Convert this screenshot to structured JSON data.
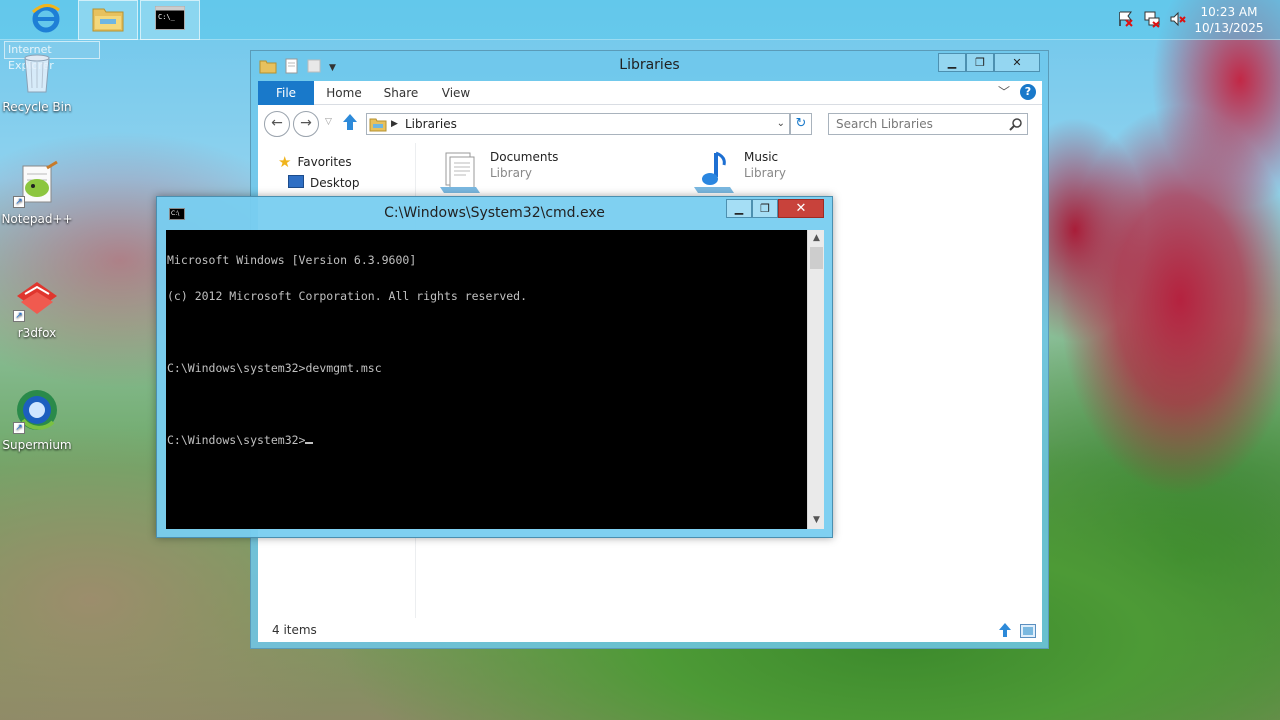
{
  "taskbar": {
    "items": [
      {
        "name": "internet-explorer-taskbar-button",
        "icon": "internet-explorer-icon"
      },
      {
        "name": "file-explorer-taskbar-button",
        "icon": "folder-icon"
      },
      {
        "name": "cmd-taskbar-button",
        "icon": "cmd-icon"
      }
    ],
    "tooltip_ghost": "Internet Explorer",
    "tray": {
      "icons": [
        "action-center-flag-icon",
        "network-icon",
        "volume-muted-icon"
      ],
      "time": "10:23 AM",
      "date": "10/13/2025"
    }
  },
  "desktop": {
    "icons": [
      {
        "label": "Recycle Bin",
        "icon": "recycle-bin-icon"
      },
      {
        "label": "Notepad++",
        "icon": "notepad-plus-plus-icon"
      },
      {
        "label": "r3dfox",
        "icon": "r3dfox-icon"
      },
      {
        "label": "Supermium",
        "icon": "supermium-icon"
      }
    ]
  },
  "explorer": {
    "title": "Libraries",
    "ribbon": {
      "file": "File",
      "home": "Home",
      "share": "Share",
      "view": "View"
    },
    "address": {
      "path": "Libraries"
    },
    "search": {
      "placeholder": "Search Libraries"
    },
    "nav": {
      "favorites": "Favorites",
      "desktop": "Desktop"
    },
    "libraries": [
      {
        "name": "Documents",
        "type": "Library",
        "icon": "documents-library-icon"
      },
      {
        "name": "Music",
        "type": "Library",
        "icon": "music-library-icon"
      }
    ],
    "status": {
      "items_count": "4 items"
    }
  },
  "cmd": {
    "title": "C:\\Windows\\System32\\cmd.exe",
    "lines": [
      "Microsoft Windows [Version 6.3.9600]",
      "(c) 2012 Microsoft Corporation. All rights reserved.",
      "",
      "C:\\Windows\\system32>devmgmt.msc",
      "",
      "C:\\Windows\\system32>"
    ]
  }
}
